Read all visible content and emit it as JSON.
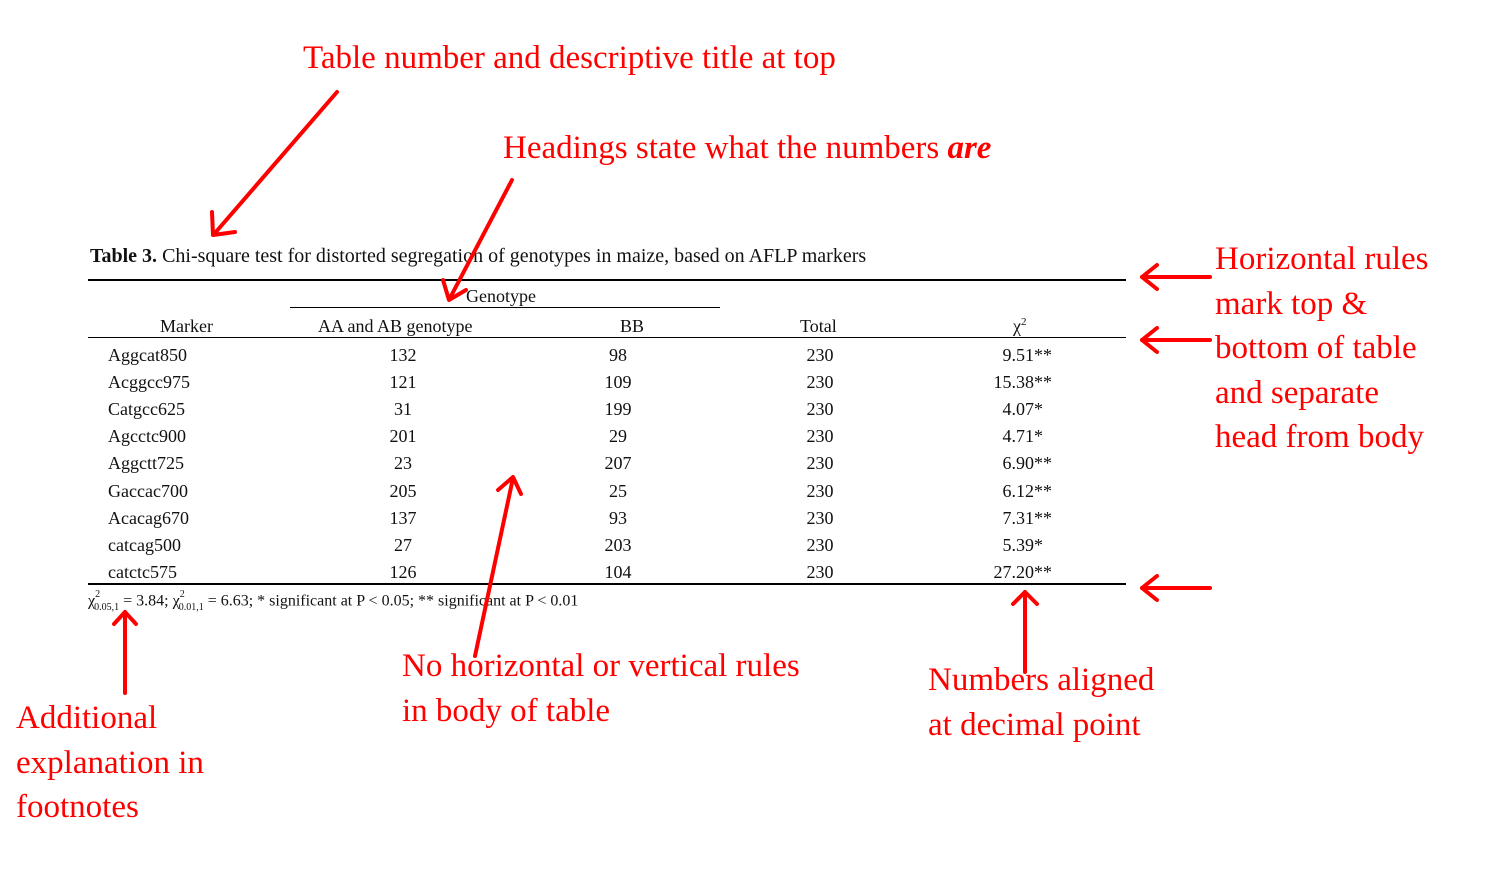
{
  "annotations": {
    "title_note": "Table number and descriptive title at top",
    "headings_note_prefix": "Headings state what the numbers ",
    "headings_note_emph": "are",
    "rules_note": [
      "Horizontal rules",
      "mark top &",
      "bottom of table",
      "and separate",
      "head from body"
    ],
    "body_note": [
      "No horizontal or vertical rules",
      "in body of table"
    ],
    "decimal_note": [
      "Numbers aligned",
      "at decimal point"
    ],
    "footnote_note": [
      "Additional",
      "explanation in",
      "footnotes"
    ]
  },
  "table": {
    "caption_label": "Table 3.",
    "caption_text": " Chi-square test for distorted segregation of genotypes in maize, based on AFLP markers",
    "spanner": "Genotype",
    "headers": {
      "marker": "Marker",
      "aa_ab": "AA and AB genotype",
      "bb": "BB",
      "total": "Total",
      "chi_symbol": "χ",
      "chi_sup": "2"
    },
    "rows": [
      {
        "marker": "Aggcat850",
        "aa_ab": "132",
        "bb": "98",
        "total": "230",
        "chi": "9.51",
        "sig": "**"
      },
      {
        "marker": "Acggcc975",
        "aa_ab": "121",
        "bb": "109",
        "total": "230",
        "chi": "15.38",
        "sig": "**"
      },
      {
        "marker": "Catgcc625",
        "aa_ab": "31",
        "bb": "199",
        "total": "230",
        "chi": "4.07",
        "sig": "*"
      },
      {
        "marker": "Agcctc900",
        "aa_ab": "201",
        "bb": "29",
        "total": "230",
        "chi": "4.71",
        "sig": "*"
      },
      {
        "marker": "Aggctt725",
        "aa_ab": "23",
        "bb": "207",
        "total": "230",
        "chi": "6.90",
        "sig": "**"
      },
      {
        "marker": "Gaccac700",
        "aa_ab": "205",
        "bb": "25",
        "total": "230",
        "chi": "6.12",
        "sig": "**"
      },
      {
        "marker": "Acacag670",
        "aa_ab": "137",
        "bb": "93",
        "total": "230",
        "chi": "7.31",
        "sig": "**"
      },
      {
        "marker": "catcag500",
        "aa_ab": "27",
        "bb": "203",
        "total": "230",
        "chi": "5.39",
        "sig": "*"
      },
      {
        "marker": "catctc575",
        "aa_ab": "126",
        "bb": "104",
        "total": "230",
        "chi": "27.20",
        "sig": "**"
      }
    ],
    "footnote": {
      "chi": "χ",
      "sup": "2",
      "sub1": "0.05,1",
      "eq1": " = 3.84; ",
      "sub2": "0.01,1",
      "eq2": " = 6.63; * significant at P < 0.05; ** significant at P < 0.01"
    }
  },
  "colors": {
    "annotation": "#ff0000",
    "table_text": "#111111"
  }
}
